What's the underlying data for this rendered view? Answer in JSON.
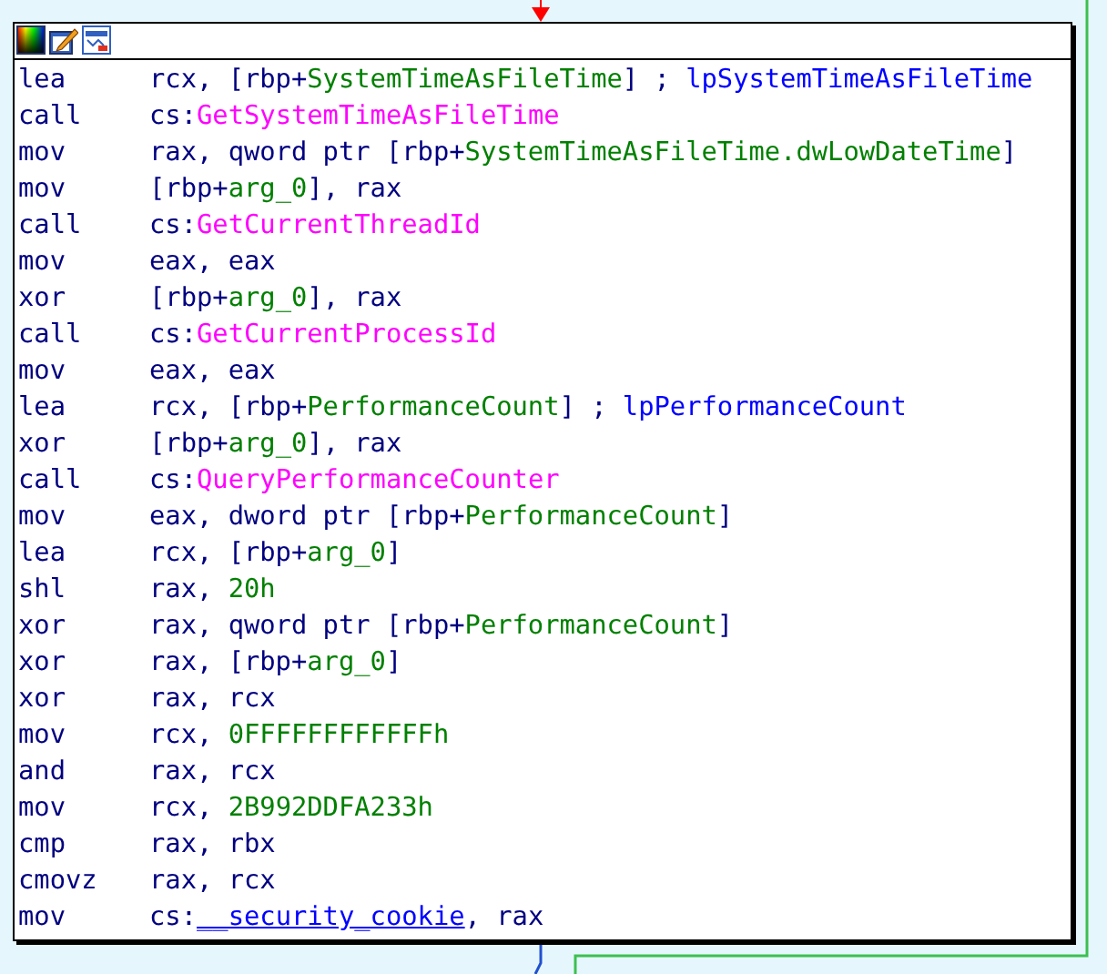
{
  "node": {
    "lines": [
      {
        "mnemonic": "lea",
        "operands": [
          {
            "kind": "text",
            "text": "rcx, [rbp+"
          },
          {
            "kind": "var",
            "text": "SystemTimeAsFileTime"
          },
          {
            "kind": "text",
            "text": "] ; "
          },
          {
            "kind": "comment",
            "text": "lpSystemTimeAsFileTime"
          }
        ]
      },
      {
        "mnemonic": "call",
        "operands": [
          {
            "kind": "text",
            "text": "cs:"
          },
          {
            "kind": "import",
            "text": "GetSystemTimeAsFileTime"
          }
        ]
      },
      {
        "mnemonic": "mov",
        "operands": [
          {
            "kind": "text",
            "text": "rax, qword ptr [rbp+"
          },
          {
            "kind": "var",
            "text": "SystemTimeAsFileTime.dwLowDateTime"
          },
          {
            "kind": "text",
            "text": "]"
          }
        ]
      },
      {
        "mnemonic": "mov",
        "operands": [
          {
            "kind": "text",
            "text": "[rbp+"
          },
          {
            "kind": "var",
            "text": "arg_0"
          },
          {
            "kind": "text",
            "text": "], rax"
          }
        ]
      },
      {
        "mnemonic": "call",
        "operands": [
          {
            "kind": "text",
            "text": "cs:"
          },
          {
            "kind": "import",
            "text": "GetCurrentThreadId"
          }
        ]
      },
      {
        "mnemonic": "mov",
        "operands": [
          {
            "kind": "text",
            "text": "eax, eax"
          }
        ]
      },
      {
        "mnemonic": "xor",
        "operands": [
          {
            "kind": "text",
            "text": "[rbp+"
          },
          {
            "kind": "var",
            "text": "arg_0"
          },
          {
            "kind": "text",
            "text": "], rax"
          }
        ]
      },
      {
        "mnemonic": "call",
        "operands": [
          {
            "kind": "text",
            "text": "cs:"
          },
          {
            "kind": "import",
            "text": "GetCurrentProcessId"
          }
        ]
      },
      {
        "mnemonic": "mov",
        "operands": [
          {
            "kind": "text",
            "text": "eax, eax"
          }
        ]
      },
      {
        "mnemonic": "lea",
        "operands": [
          {
            "kind": "text",
            "text": "rcx, [rbp+"
          },
          {
            "kind": "var",
            "text": "PerformanceCount"
          },
          {
            "kind": "text",
            "text": "] ; "
          },
          {
            "kind": "comment",
            "text": "lpPerformanceCount"
          }
        ]
      },
      {
        "mnemonic": "xor",
        "operands": [
          {
            "kind": "text",
            "text": "[rbp+"
          },
          {
            "kind": "var",
            "text": "arg_0"
          },
          {
            "kind": "text",
            "text": "], rax"
          }
        ]
      },
      {
        "mnemonic": "call",
        "operands": [
          {
            "kind": "text",
            "text": "cs:"
          },
          {
            "kind": "import",
            "text": "QueryPerformanceCounter"
          }
        ]
      },
      {
        "mnemonic": "mov",
        "operands": [
          {
            "kind": "text",
            "text": "eax, dword ptr [rbp+"
          },
          {
            "kind": "var",
            "text": "PerformanceCount"
          },
          {
            "kind": "text",
            "text": "]"
          }
        ]
      },
      {
        "mnemonic": "lea",
        "operands": [
          {
            "kind": "text",
            "text": "rcx, [rbp+"
          },
          {
            "kind": "var",
            "text": "arg_0"
          },
          {
            "kind": "text",
            "text": "]"
          }
        ]
      },
      {
        "mnemonic": "shl",
        "operands": [
          {
            "kind": "text",
            "text": "rax, "
          },
          {
            "kind": "number",
            "text": "20h"
          }
        ]
      },
      {
        "mnemonic": "xor",
        "operands": [
          {
            "kind": "text",
            "text": "rax, qword ptr [rbp+"
          },
          {
            "kind": "var",
            "text": "PerformanceCount"
          },
          {
            "kind": "text",
            "text": "]"
          }
        ]
      },
      {
        "mnemonic": "xor",
        "operands": [
          {
            "kind": "text",
            "text": "rax, [rbp+"
          },
          {
            "kind": "var",
            "text": "arg_0"
          },
          {
            "kind": "text",
            "text": "]"
          }
        ]
      },
      {
        "mnemonic": "xor",
        "operands": [
          {
            "kind": "text",
            "text": "rax, rcx"
          }
        ]
      },
      {
        "mnemonic": "mov",
        "operands": [
          {
            "kind": "text",
            "text": "rcx, "
          },
          {
            "kind": "number",
            "text": "0FFFFFFFFFFFFh"
          }
        ]
      },
      {
        "mnemonic": "and",
        "operands": [
          {
            "kind": "text",
            "text": "rax, rcx"
          }
        ]
      },
      {
        "mnemonic": "mov",
        "operands": [
          {
            "kind": "text",
            "text": "rcx, "
          },
          {
            "kind": "number",
            "text": "2B992DDFA233h"
          }
        ]
      },
      {
        "mnemonic": "cmp",
        "operands": [
          {
            "kind": "text",
            "text": "rax, rbx"
          }
        ]
      },
      {
        "mnemonic": "cmovz",
        "operands": [
          {
            "kind": "text",
            "text": "rax, rcx"
          }
        ]
      },
      {
        "mnemonic": "mov",
        "operands": [
          {
            "kind": "text",
            "text": "cs:"
          },
          {
            "kind": "link",
            "text": "__security_cookie"
          },
          {
            "kind": "text",
            "text": ", rax"
          }
        ]
      }
    ]
  }
}
